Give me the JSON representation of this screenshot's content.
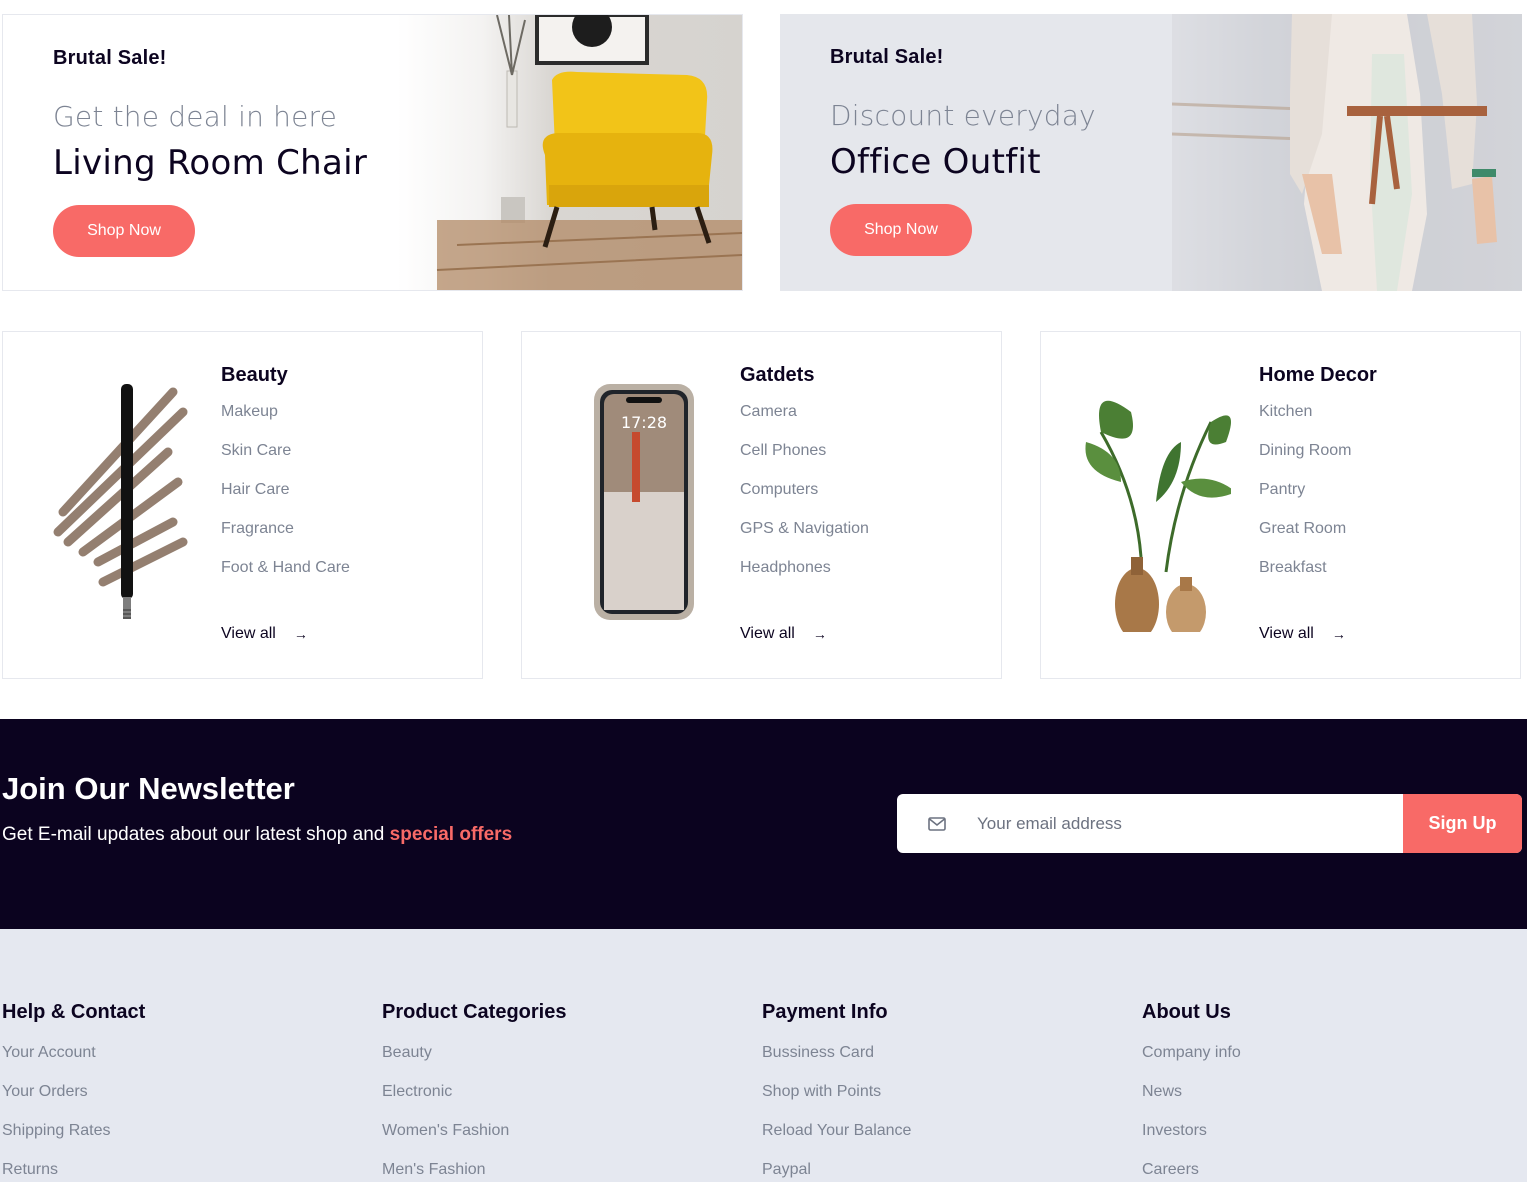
{
  "promos": [
    {
      "kicker": "Brutal Sale!",
      "subtitle": "Get the deal in here",
      "title": "Living Room Chair",
      "button": "Shop Now"
    },
    {
      "kicker": "Brutal Sale!",
      "subtitle": "Discount everyday",
      "title": "Office Outfit",
      "button": "Shop Now"
    }
  ],
  "categories": [
    {
      "title": "Beauty",
      "items": [
        "Makeup",
        "Skin Care",
        "Hair Care",
        "Fragrance",
        "Foot & Hand Care"
      ],
      "view_all": "View all",
      "icon": "eyebrow-pencil"
    },
    {
      "title": "Gatdets",
      "items": [
        "Camera",
        "Cell Phones",
        "Computers",
        "GPS & Navigation",
        "Headphones"
      ],
      "view_all": "View all",
      "icon": "smartphone",
      "phone_time": "17:28"
    },
    {
      "title": "Home Decor",
      "items": [
        "Kitchen",
        "Dining Room",
        "Pantry",
        "Great Room",
        "Breakfast"
      ],
      "view_all": "View all",
      "icon": "potted-plant"
    }
  ],
  "newsletter": {
    "title": "Join Our Newsletter",
    "subtitle": "Get E-mail updates about our latest shop and",
    "highlight": "special offers",
    "placeholder": "Your email address",
    "button": "Sign Up"
  },
  "footer": {
    "columns": [
      {
        "title": "Help & Contact",
        "links": [
          "Your Account",
          "Your Orders",
          "Shipping Rates",
          "Returns"
        ]
      },
      {
        "title": "Product Categories",
        "links": [
          "Beauty",
          "Electronic",
          "Women's Fashion",
          "Men's Fashion"
        ]
      },
      {
        "title": "Payment Info",
        "links": [
          "Bussiness Card",
          "Shop with Points",
          "Reload Your Balance",
          "Paypal"
        ]
      },
      {
        "title": "About Us",
        "links": [
          "Company info",
          "News",
          "Investors",
          "Careers"
        ]
      }
    ]
  },
  "colors": {
    "accent": "#f86a67",
    "dark": "#0b031f",
    "muted": "#7d8493",
    "footer_bg": "#e5e8f0"
  }
}
